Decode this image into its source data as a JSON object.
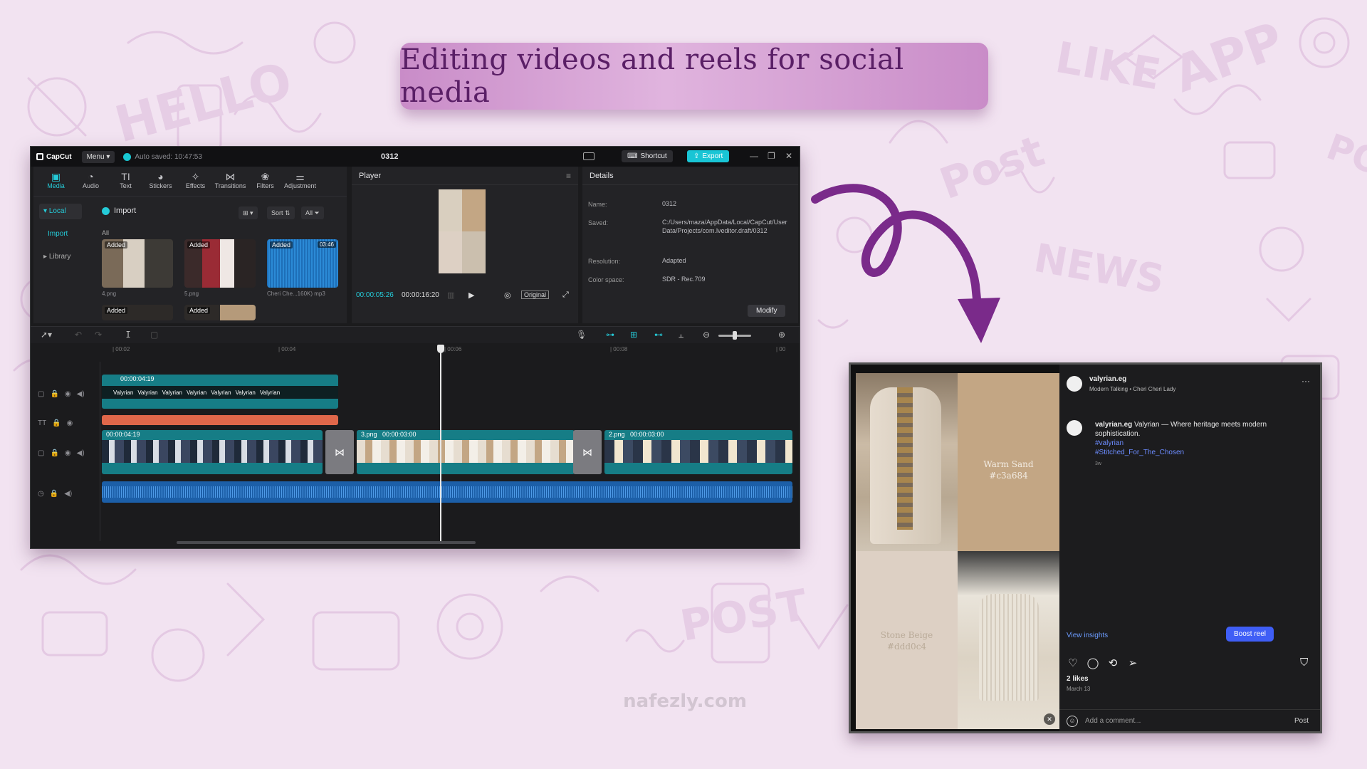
{
  "banner": {
    "title": "Editing videos and reels for social media"
  },
  "capcut": {
    "app_name": "CapCut",
    "menu_label": "Menu",
    "autosave": "Auto saved: 10:47:53",
    "project_title": "0312",
    "shortcut_label": "Shortcut",
    "export_label": "Export",
    "tools": [
      {
        "label": "Media",
        "icon": "media-icon"
      },
      {
        "label": "Audio",
        "icon": "audio-icon"
      },
      {
        "label": "Text",
        "icon": "text-icon"
      },
      {
        "label": "Stickers",
        "icon": "sticker-icon"
      },
      {
        "label": "Effects",
        "icon": "effects-icon"
      },
      {
        "label": "Transitions",
        "icon": "transition-icon"
      },
      {
        "label": "Filters",
        "icon": "filter-icon"
      },
      {
        "label": "Adjustment",
        "icon": "adjust-icon"
      }
    ],
    "side_nav": {
      "local": "Local",
      "import": "Import",
      "library": "Library"
    },
    "media_toolbar": {
      "import": "Import",
      "sort": "Sort",
      "all_filter": "All"
    },
    "all_label": "All",
    "media_items": [
      {
        "badge": "Added",
        "name": "4.png",
        "duration": ""
      },
      {
        "badge": "Added",
        "name": "5.png",
        "duration": ""
      },
      {
        "badge": "Added",
        "name": "Cheri Che...160K) mp3",
        "duration": "03:46"
      },
      {
        "badge": "Added",
        "name": "",
        "duration": ""
      },
      {
        "badge": "Added",
        "name": "",
        "duration": ""
      }
    ],
    "player": {
      "header": "Player",
      "current_time": "00:00:05:26",
      "total_time": "00:00:16:20",
      "original_label": "Original"
    },
    "details": {
      "header": "Details",
      "name_label": "Name:",
      "name_value": "0312",
      "saved_label": "Saved:",
      "saved_value": "C:/Users/maza/AppData/Local/CapCut/User Data/Projects/com.lveditor.draft/0312",
      "resolution_label": "Resolution:",
      "resolution_value": "Adapted",
      "color_label": "Color space:",
      "color_value": "SDR - Rec.709",
      "modify_label": "Modify"
    },
    "ruler": [
      "| 00:02",
      "| 00:04",
      "| 00:06",
      "| 00:08",
      "| 00"
    ],
    "timeline": {
      "text_clip_duration": "00:00:04:19",
      "text_clip_word": "Valyrian",
      "video_clip1_duration": "00:00:04:19",
      "video_clip2_label": "3.png",
      "video_clip2_duration": "00:00:03:00",
      "video_clip3_label": "2.png",
      "video_clip3_duration": "00:00:03:00"
    }
  },
  "instagram": {
    "username": "valyrian.eg",
    "audio": "Modern Talking • Cheri Cheri Lady",
    "caption_user": "valyrian.eg",
    "caption_text": "Valyrian — Where heritage meets modern sophistication.",
    "hashtag1": "#valyrian",
    "hashtag2": "#Stitched_For_The_Chosen",
    "caption_time": "3w",
    "swatch1_name": "Warm Sand",
    "swatch1_hex": "#c3a684",
    "swatch2_name": "Stone Beige",
    "swatch2_hex": "#ddd0c4",
    "view_insights": "View insights",
    "boost_label": "Boost reel",
    "likes": "2 likes",
    "date": "March 13",
    "comment_placeholder": "Add a comment...",
    "post_label": "Post",
    "more_label": "···"
  },
  "watermark": "nafezly.com",
  "colors": {
    "background": "#f2e3f1",
    "accent_teal": "#19c5d5",
    "arrow_purple": "#7a2a8a",
    "boost_blue": "#3f5ef6"
  }
}
